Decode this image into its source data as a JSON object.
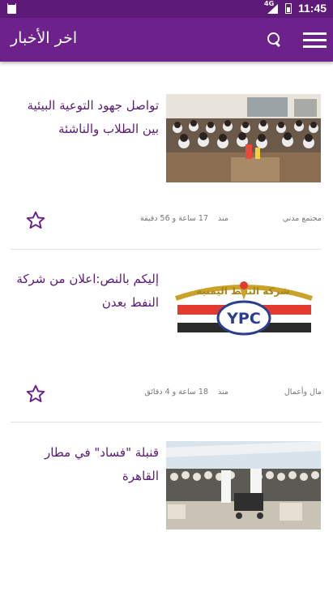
{
  "status_bar": {
    "time": "11:45",
    "network": "4G"
  },
  "app_bar": {
    "title": "اخر الأخبار"
  },
  "articles": [
    {
      "headline": "تواصل جهود التوعية البيئية بين الطلاب والناشئة",
      "source": "مجتمع مدني",
      "since": "منذ",
      "ago": "17 ساعة و 56 دقيقة",
      "image": "classroom-students-photo"
    },
    {
      "headline": "إليكم بالنص:اعلان من شركة النفط بعدن",
      "source": "مال وأعمال",
      "since": "منذ",
      "ago": "18 ساعة و 4 دقائق",
      "image": "ypc-logo",
      "logo_text": "YPC",
      "logo_arabic": "شركة النفط اليمنية"
    },
    {
      "headline": "قنبلة \"فساد\" في مطار القاهرة",
      "image": "airport-crowd-photo"
    }
  ],
  "icons": {
    "favorite": "star-outline-icon",
    "search": "search-icon",
    "menu": "menu-icon"
  },
  "colors": {
    "primary": "#6c228a",
    "status_bar": "#5e1a78",
    "headline": "#5a1a78"
  }
}
